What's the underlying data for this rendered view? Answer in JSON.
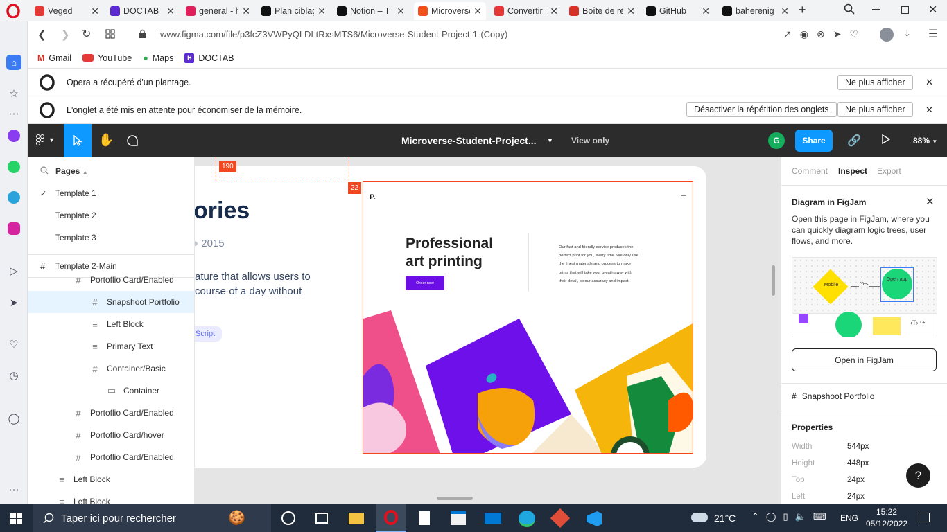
{
  "browser": {
    "tabs": [
      {
        "title": "Veged",
        "favicon": "youtube-icon",
        "color": "#e53935"
      },
      {
        "title": "DOCTAB",
        "favicon": "doctab-icon",
        "color": "#5b2bd1"
      },
      {
        "title": "general - h",
        "favicon": "slack-icon",
        "color": "#e01e5a"
      },
      {
        "title": "Plan ciblag",
        "favicon": "notion-icon",
        "color": "#111111"
      },
      {
        "title": "Notion – T",
        "favicon": "notion-icon",
        "color": "#111111"
      },
      {
        "title": "Microverse",
        "favicon": "figma-icon",
        "color": "#f24e1e"
      },
      {
        "title": "Convertir I",
        "favicon": "convert-icon",
        "color": "#e53935"
      },
      {
        "title": "Boîte de ré",
        "favicon": "gmail-icon",
        "color": "#d93025"
      },
      {
        "title": "GitHub",
        "favicon": "github-icon",
        "color": "#111111"
      },
      {
        "title": "baherenig",
        "favicon": "github-icon",
        "color": "#111111"
      }
    ],
    "url": "www.figma.com/file/p3fcZ3VWPyQLDLtRxsMTS6/Microverse-Student-Project-1-(Copy)",
    "bookmarks": [
      "Gmail",
      "YouTube",
      "Maps",
      "DOCTAB"
    ]
  },
  "notices": [
    {
      "text": "Opera a récupéré d'un plantage.",
      "button": "Ne plus afficher"
    },
    {
      "text": "L'onglet a été mis en attente pour économiser de la mémoire.",
      "button1": "Désactiver la répétition des onglets",
      "button2": "Ne plus afficher"
    }
  ],
  "figma": {
    "file_title": "Microverse-Student-Project...",
    "mode": "View only",
    "avatar": "G",
    "share": "Share",
    "zoom": "88%"
  },
  "left_panel": {
    "pages_label": "Pages",
    "pages": [
      "Template 1",
      "Template 2",
      "Template 3"
    ],
    "current_frame": "Template 2-Main",
    "layers": [
      {
        "name": "Portoflio Card/Enabled",
        "icon": "#",
        "indent": 1
      },
      {
        "name": "Snapshoot Portfolio",
        "icon": "#",
        "indent": 2,
        "selected": true
      },
      {
        "name": "Left Block",
        "icon": "≡",
        "indent": 2
      },
      {
        "name": "Primary Text",
        "icon": "≡",
        "indent": 2
      },
      {
        "name": "Container/Basic",
        "icon": "#",
        "indent": 2
      },
      {
        "name": "Container",
        "icon": "▭",
        "indent": 3
      },
      {
        "name": "Portoflio Card/Enabled",
        "icon": "#",
        "indent": 1
      },
      {
        "name": "Portoflio Card/hover",
        "icon": "#",
        "indent": 1
      },
      {
        "name": "Portoflio Card/Enabled",
        "icon": "#",
        "indent": 1
      },
      {
        "name": "Left Block",
        "icon": "≡",
        "indent": 0
      },
      {
        "name": "Left Block",
        "icon": "≡",
        "indent": 0
      }
    ]
  },
  "canvas": {
    "heading_fragment": "ories",
    "year": "2015",
    "desc_line1": "ature that allows users to",
    "desc_line2": "course of a day without",
    "tag": "Script",
    "measure_top": "190",
    "measure_left": "22",
    "snapshot": {
      "logo": "P.",
      "headline1": "Professional",
      "headline2": "art printing",
      "cta": "Order now",
      "body": [
        "Our fast and friendly service produces the",
        "perfect print for you, every time. We only use",
        "the finest materials and process to make",
        "prints that will take your breath away with",
        "their detail, colour accuracy and impact."
      ]
    }
  },
  "right_panel": {
    "tabs": [
      "Comment",
      "Inspect",
      "Export"
    ],
    "active_tab": "Inspect",
    "figjam_title": "Diagram in FigJam",
    "figjam_desc": "Open this page in FigJam, where you can quickly diagram logic trees, user flows, and more.",
    "figjam_mobile": "Mobile",
    "figjam_yes": "Yes",
    "figjam_open": "Open app",
    "figjam_button": "Open in FigJam",
    "selection": "Snapshoot Portfolio",
    "properties_title": "Properties",
    "properties": [
      {
        "label": "Width",
        "value": "544px"
      },
      {
        "label": "Height",
        "value": "448px"
      },
      {
        "label": "Top",
        "value": "24px"
      },
      {
        "label": "Left",
        "value": "24px"
      }
    ],
    "help": "?"
  },
  "taskbar": {
    "search_placeholder": "Taper ici pour rechercher",
    "weather": "21°C",
    "lang": "ENG",
    "time": "15:22",
    "date": "05/12/2022"
  }
}
